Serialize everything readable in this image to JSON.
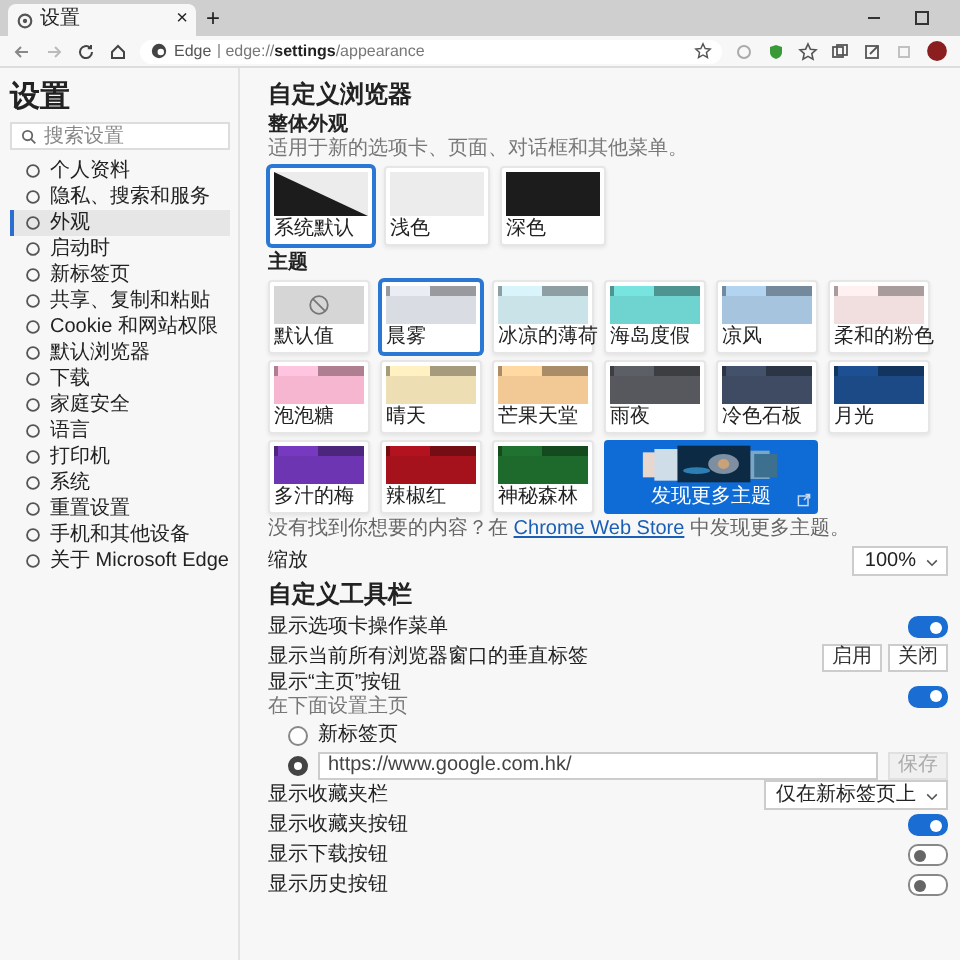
{
  "browser": {
    "tab": {
      "title": "设置",
      "close": "×"
    },
    "new_tab": "+",
    "address": {
      "site": "Edge",
      "url": "edge://**settings**/appearance"
    }
  },
  "sidebar": {
    "title": "设置",
    "search": {
      "placeholder": "搜索设置"
    },
    "items": [
      {
        "label": "个人资料",
        "selected": false
      },
      {
        "label": "隐私、搜索和服务",
        "selected": false
      },
      {
        "label": "外观",
        "selected": true
      },
      {
        "label": "启动时",
        "selected": false
      },
      {
        "label": "新标签页",
        "selected": false
      },
      {
        "label": "共享、复制和粘贴",
        "selected": false
      },
      {
        "label": "Cookie 和网站权限",
        "selected": false
      },
      {
        "label": "默认浏览器",
        "selected": false
      },
      {
        "label": "下载",
        "selected": false
      },
      {
        "label": "家庭安全",
        "selected": false
      },
      {
        "label": "语言",
        "selected": false
      },
      {
        "label": "打印机",
        "selected": false
      },
      {
        "label": "系统",
        "selected": false
      },
      {
        "label": "重置设置",
        "selected": false
      },
      {
        "label": "手机和其他设备",
        "selected": false
      },
      {
        "label": "关于 Microsoft Edge",
        "selected": false
      }
    ]
  },
  "main": {
    "title": "自定义浏览器",
    "appearance": {
      "label": "整体外观",
      "description": "适用于新的选项卡、页面、对话框和其他菜单。",
      "options": [
        {
          "label": "系统默认",
          "kind": "system",
          "selected": true
        },
        {
          "label": "浅色",
          "kind": "light",
          "selected": false
        },
        {
          "label": "深色",
          "kind": "dark",
          "selected": false
        }
      ]
    },
    "themes": {
      "label": "主题",
      "items": [
        {
          "label": "默认值",
          "kind": "default",
          "color": "#d6d6d6",
          "selected": false
        },
        {
          "label": "晨雾",
          "kind": "theme",
          "color": "#d9dce2",
          "selected": true
        },
        {
          "label": "冰凉的薄荷",
          "kind": "theme",
          "color": "#c9e3e8",
          "selected": false
        },
        {
          "label": "海岛度假",
          "kind": "theme",
          "color": "#6fd3cf",
          "selected": false
        },
        {
          "label": "凉风",
          "kind": "theme",
          "color": "#a6c4de",
          "selected": false
        },
        {
          "label": "柔和的粉色",
          "kind": "theme",
          "color": "#f1dfe0",
          "selected": false
        },
        {
          "label": "泡泡糖",
          "kind": "theme",
          "color": "#f7b6cf",
          "selected": false
        },
        {
          "label": "晴天",
          "kind": "theme",
          "color": "#eddfb3",
          "selected": false
        },
        {
          "label": "芒果天堂",
          "kind": "theme",
          "color": "#f2c995",
          "selected": false
        },
        {
          "label": "雨夜",
          "kind": "theme",
          "color": "#56585e",
          "selected": false
        },
        {
          "label": "冷色石板",
          "kind": "theme",
          "color": "#3e4b63",
          "selected": false
        },
        {
          "label": "月光",
          "kind": "theme",
          "color": "#1b4a87",
          "selected": false
        },
        {
          "label": "多汁的梅",
          "kind": "theme",
          "color": "#6d35b2",
          "selected": false
        },
        {
          "label": "辣椒红",
          "kind": "theme",
          "color": "#a5121c",
          "selected": false
        },
        {
          "label": "神秘森林",
          "kind": "theme",
          "color": "#1e6a2c",
          "selected": false
        }
      ],
      "discover": {
        "label": "发现更多主题"
      }
    },
    "store_note": {
      "prefix": "没有找到你想要的内容？在",
      "link": "Chrome Web Store",
      "suffix": "中发现更多主题。"
    },
    "zoom": {
      "label": "缩放",
      "value": "100%"
    },
    "toolbar": {
      "title": "自定义工具栏",
      "rows": [
        {
          "kind": "toggle",
          "label": "显示选项卡操作菜单",
          "on": true
        },
        {
          "kind": "buttons",
          "label": "显示当前所有浏览器窗口的垂直标签",
          "buttons": [
            "启用",
            "关闭"
          ]
        },
        {
          "kind": "toggle",
          "label": "显示“主页”按钮",
          "description": "在下面设置主页",
          "on": true
        },
        {
          "kind": "radios",
          "options": [
            {
              "kind": "page",
              "label": "新标签页",
              "selected": false
            },
            {
              "kind": "url",
              "value": "https://www.google.com.hk/",
              "button": "保存",
              "selected": true
            }
          ]
        },
        {
          "kind": "select",
          "label": "显示收藏夹栏",
          "value": "仅在新标签页上"
        },
        {
          "kind": "toggle",
          "label": "显示收藏夹按钮",
          "on": true
        },
        {
          "kind": "toggle",
          "label": "显示下载按钮",
          "on": false
        },
        {
          "kind": "toggle",
          "label": "显示历史按钮",
          "on": false
        }
      ]
    }
  }
}
